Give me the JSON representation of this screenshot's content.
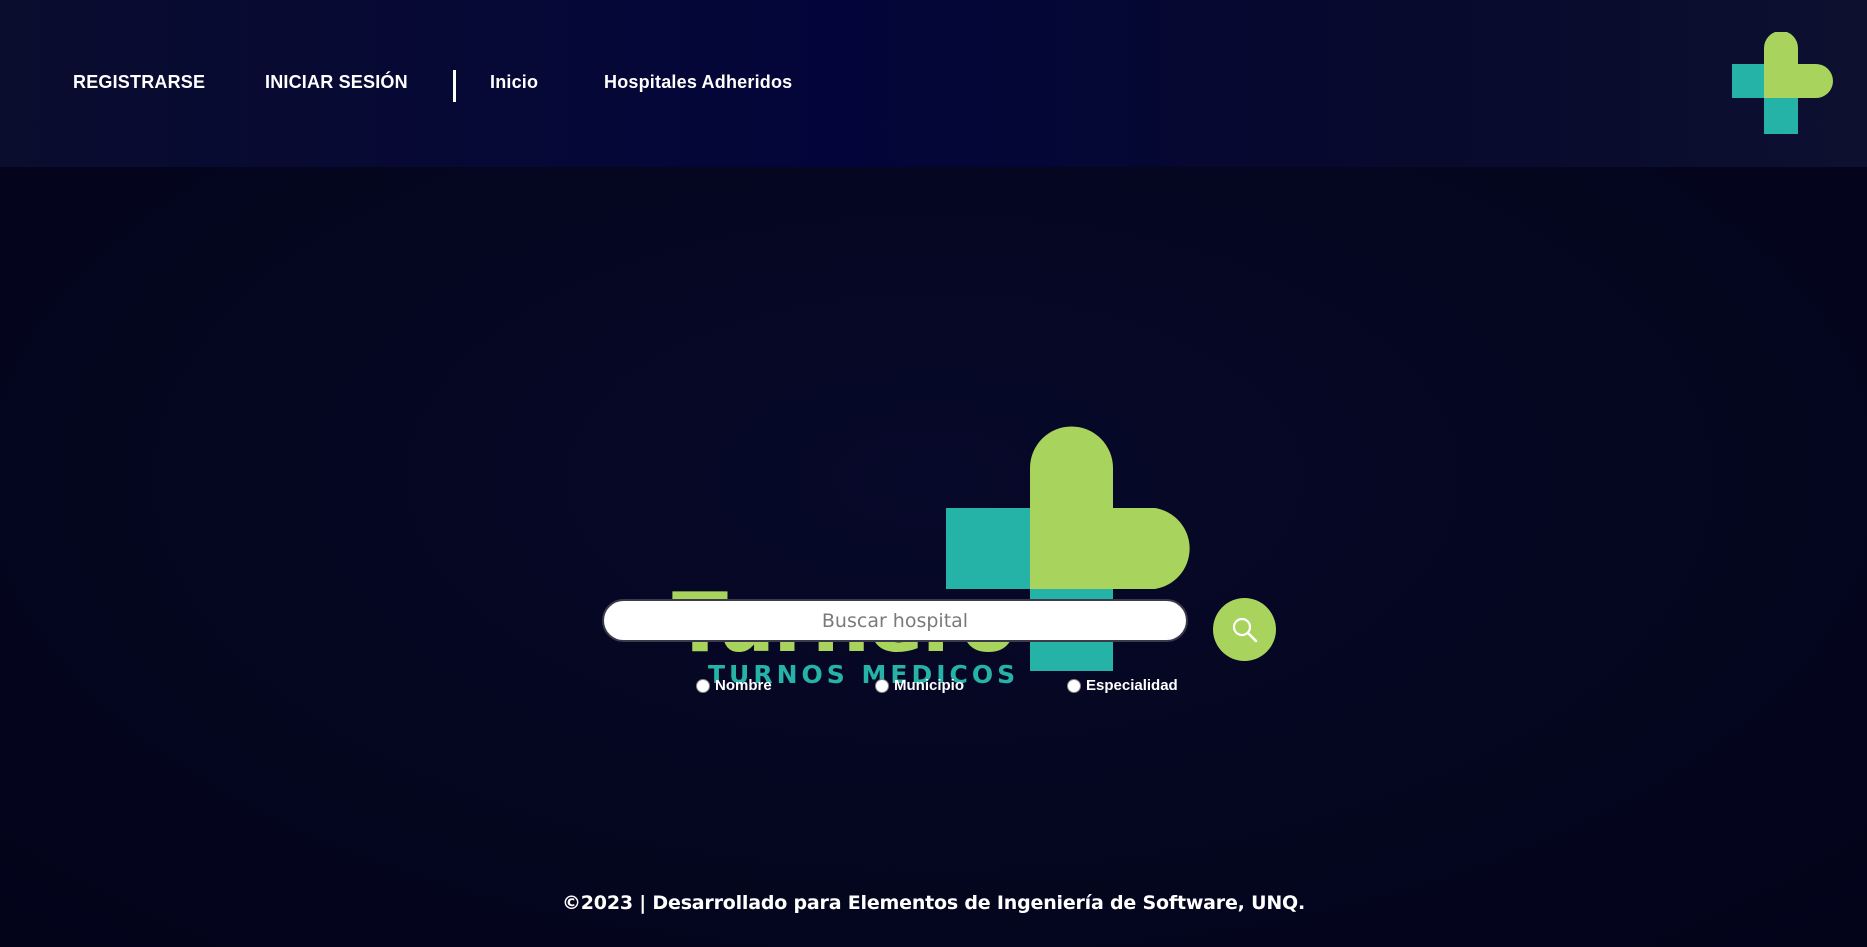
{
  "nav": {
    "register": "REGISTRARSE",
    "login": "INICIAR SESIÓN",
    "home": "Inicio",
    "hospitals": "Hospitales Adheridos"
  },
  "brand": {
    "name": "Turnero",
    "tagline": "TURNOS MEDICOS",
    "logo_icon": "medical-cross-icon",
    "colors": {
      "green": "#a8d35c",
      "teal": "#26b3a7",
      "background": "#04041c"
    }
  },
  "search": {
    "placeholder": "Buscar hospital",
    "value": "",
    "button_icon": "search-icon",
    "filters": [
      {
        "label": "Nombre",
        "checked": false
      },
      {
        "label": "Municipio",
        "checked": false
      },
      {
        "label": "Especialidad",
        "checked": false
      }
    ]
  },
  "footer": {
    "text": "©2023 | Desarrollado para Elementos de Ingeniería de Software, UNQ."
  }
}
